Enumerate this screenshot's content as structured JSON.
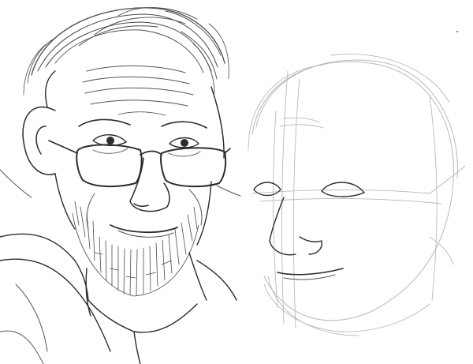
{
  "scene": {
    "subjects": [
      "elderly-man-with-glasses-and-beard",
      "construction-sketch-face"
    ],
    "background_color": "#ffffff",
    "ink_color": "#2b2b2b",
    "guide_color": "#b9b9b9"
  }
}
